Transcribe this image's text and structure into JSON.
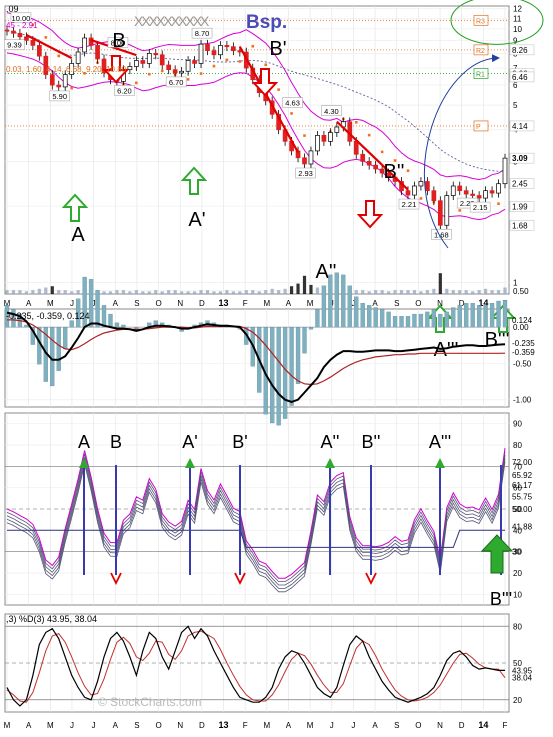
{
  "header": {
    "price_label": ".09",
    "ma_params": "45 - 2.91",
    "symbol": "Bsp.",
    "redacted_ticker": "XXXXXXXXXX",
    "overlay_params": "0.03, 1.60, 4.14, 6.68, 9.20, 10.80"
  },
  "watermark": "© StockCharts.com",
  "chart_data": [
    {
      "panel": "price",
      "type": "candlestick",
      "title": "Bsp.",
      "x_months": [
        "M",
        "A",
        "M",
        "J",
        "J",
        "A",
        "S",
        "O",
        "N",
        "D",
        "13",
        "F",
        "M",
        "A",
        "M",
        "J",
        "J",
        "A",
        "S",
        "O",
        "N",
        "D",
        "14",
        "F"
      ],
      "y_ticks": [
        1,
        2,
        3,
        4,
        5,
        6,
        7,
        8,
        9,
        10,
        11,
        12
      ],
      "ylim": [
        0.9,
        12.3
      ],
      "scale": "log",
      "close_series": [
        9.8,
        9.6,
        9.3,
        9.0,
        8.6,
        7.8,
        6.6,
        6.0,
        5.9,
        6.6,
        7.3,
        8.1,
        9.2,
        8.6,
        7.6,
        6.7,
        6.3,
        6.2,
        6.9,
        7.1,
        7.5,
        7.3,
        8.0,
        7.9,
        7.2,
        6.9,
        6.7,
        6.8,
        7.5,
        7.3,
        8.7,
        8.2,
        7.9,
        8.6,
        8.5,
        8.2,
        8.1,
        7.0,
        6.3,
        5.6,
        5.2,
        4.6,
        4.0,
        3.6,
        3.3,
        3.1,
        2.93,
        3.3,
        3.8,
        3.6,
        3.9,
        4.1,
        4.3,
        3.6,
        3.2,
        3.0,
        2.9,
        2.8,
        2.7,
        2.6,
        2.5,
        2.3,
        2.21,
        2.4,
        2.5,
        2.3,
        2.1,
        1.68,
        2.2,
        2.4,
        2.3,
        2.23,
        2.2,
        2.15,
        2.3,
        2.25,
        2.45,
        3.09
      ],
      "price_annotations": [
        "10.00",
        "9.39",
        "8.00",
        "8.70",
        "6.70",
        "6.20",
        "5.90",
        "4.63",
        "4.30",
        "2.93",
        "2.21",
        "2.23",
        "2.15",
        "1.68"
      ],
      "right_axis_labels": [
        "8.26",
        "6.66",
        "6.46",
        "4.14",
        "3.09",
        "2.45",
        "1.99",
        "1.68"
      ],
      "level_markers": [
        "R3",
        "R2",
        "R1",
        "P"
      ],
      "level_values": [
        10.8,
        8.26,
        6.66,
        4.14
      ],
      "wave_labels": [
        "A",
        "B",
        "A'",
        "B'",
        "A''",
        "B''",
        "A'''",
        "B'''"
      ],
      "volume": [
        3,
        3,
        3,
        2,
        3,
        4,
        5,
        6,
        3,
        3,
        2,
        3,
        4,
        3,
        3,
        2,
        2,
        3,
        3,
        2,
        3,
        2,
        2,
        3,
        2,
        3,
        3,
        2,
        2,
        2,
        3,
        3,
        2,
        2,
        3,
        2,
        2,
        3,
        3,
        2,
        3,
        4,
        3,
        4,
        6,
        8,
        14,
        7,
        5,
        6,
        4,
        5,
        4,
        3,
        3,
        3,
        2,
        3,
        3,
        2,
        3,
        3,
        3,
        3,
        2,
        3,
        4,
        16,
        4,
        3,
        3,
        3,
        2,
        3,
        4,
        3,
        3,
        5
      ],
      "volume_highlight": "#c06070"
    },
    {
      "panel": "macd",
      "type": "line",
      "params": "-0.235, -0.359, 0.124",
      "legend": [
        "-0.235",
        "-0.359",
        "0.124"
      ],
      "y_ticks": [
        0.5,
        0.0,
        -0.5,
        -1.0
      ],
      "ylim": [
        -1.1,
        0.25
      ],
      "right_axis_labels": [
        "0.124",
        "-0.235",
        "-0.359"
      ],
      "macd": [
        0.2,
        0.18,
        0.15,
        0.08,
        -0.05,
        -0.2,
        -0.35,
        -0.45,
        -0.45,
        -0.4,
        -0.28,
        -0.15,
        0.0,
        0.05,
        0.05,
        0.02,
        0.0,
        -0.02,
        -0.02,
        -0.03,
        -0.05,
        -0.03,
        0.0,
        0.02,
        0.02,
        0.01,
        0.0,
        -0.02,
        -0.02,
        0.0,
        0.02,
        0.04,
        0.03,
        0.02,
        0.02,
        0.01,
        0.0,
        -0.1,
        -0.25,
        -0.45,
        -0.65,
        -0.8,
        -0.92,
        -1.0,
        -1.03,
        -1.0,
        -0.9,
        -0.8,
        -0.7,
        -0.55,
        -0.45,
        -0.38,
        -0.33,
        -0.33,
        -0.34,
        -0.34,
        -0.33,
        -0.32,
        -0.32,
        -0.32,
        -0.33,
        -0.33,
        -0.32,
        -0.31,
        -0.3,
        -0.29,
        -0.28,
        -0.3,
        -0.29,
        -0.27,
        -0.26,
        -0.25,
        -0.25,
        -0.26,
        -0.26,
        -0.25,
        -0.24,
        -0.235
      ],
      "signal": [
        0.1,
        0.1,
        0.09,
        0.07,
        0.03,
        -0.03,
        -0.1,
        -0.18,
        -0.25,
        -0.3,
        -0.31,
        -0.28,
        -0.23,
        -0.17,
        -0.12,
        -0.08,
        -0.06,
        -0.04,
        -0.03,
        -0.03,
        -0.03,
        -0.03,
        -0.02,
        -0.01,
        0.0,
        0.0,
        0.0,
        0.0,
        -0.01,
        -0.01,
        0.0,
        0.01,
        0.01,
        0.01,
        0.01,
        0.01,
        0.01,
        -0.02,
        -0.07,
        -0.15,
        -0.25,
        -0.36,
        -0.47,
        -0.58,
        -0.67,
        -0.74,
        -0.78,
        -0.79,
        -0.78,
        -0.74,
        -0.69,
        -0.63,
        -0.57,
        -0.52,
        -0.48,
        -0.45,
        -0.43,
        -0.41,
        -0.4,
        -0.39,
        -0.38,
        -0.38,
        -0.37,
        -0.37,
        -0.36,
        -0.36,
        -0.36,
        -0.36,
        -0.36,
        -0.36,
        -0.36,
        -0.36,
        -0.36,
        -0.36,
        -0.36,
        -0.36,
        -0.36,
        -0.359
      ]
    },
    {
      "panel": "rsi",
      "type": "line",
      "y_ticks": [
        90,
        80,
        70,
        60,
        50,
        40,
        30,
        20,
        10
      ],
      "ylim": [
        5,
        95
      ],
      "right_axis_labels": [
        "72.00",
        "65.92",
        "61.17",
        "55.75",
        "50.00",
        "41.88",
        "30"
      ],
      "wave_labels": [
        "A",
        "B",
        "A'",
        "B'",
        "A''",
        "B''",
        "A'''",
        "B'''"
      ]
    },
    {
      "panel": "stochastic",
      "type": "line",
      "params": ",3) %D(3) 43.95, 38.04",
      "legend": [
        "43.95",
        "38.04"
      ],
      "y_ticks": [
        80,
        50,
        20
      ],
      "ylim": [
        10,
        90
      ],
      "right_axis_labels": [
        "43.95",
        "38.04"
      ],
      "pct_k": [
        30,
        20,
        15,
        20,
        40,
        65,
        75,
        78,
        70,
        55,
        40,
        30,
        22,
        20,
        35,
        55,
        70,
        75,
        68,
        55,
        40,
        60,
        75,
        70,
        55,
        45,
        60,
        75,
        80,
        70,
        78,
        72,
        60,
        50,
        40,
        30,
        22,
        20,
        18,
        18,
        22,
        30,
        45,
        55,
        60,
        58,
        50,
        40,
        30,
        25,
        22,
        30,
        48,
        65,
        72,
        68,
        55,
        45,
        35,
        28,
        22,
        20,
        18,
        20,
        22,
        25,
        30,
        40,
        52,
        58,
        60,
        55,
        48,
        45,
        46,
        45,
        44,
        43.95
      ],
      "pct_d": [
        28,
        24,
        19,
        18,
        26,
        42,
        60,
        72,
        74,
        67,
        55,
        42,
        31,
        24,
        25,
        37,
        53,
        67,
        71,
        66,
        55,
        52,
        58,
        68,
        67,
        57,
        53,
        60,
        72,
        75,
        76,
        73,
        70,
        61,
        50,
        40,
        31,
        24,
        20,
        19,
        19,
        24,
        32,
        43,
        53,
        58,
        56,
        49,
        40,
        32,
        26,
        26,
        33,
        48,
        62,
        68,
        65,
        56,
        45,
        36,
        28,
        23,
        20,
        19,
        20,
        22,
        26,
        32,
        41,
        50,
        57,
        58,
        54,
        49,
        46,
        45,
        45,
        38.04
      ]
    }
  ],
  "colors": {
    "bollinger": "#d800d8",
    "sar": "#f07020",
    "down_trend": "#e00000",
    "up_arrow": "#2eaa2e",
    "down_arrow": "#e00000",
    "vertical_line": "#3a3ab0",
    "macd_line": "#000000",
    "signal_line": "#b02020",
    "histogram": "#7fb0c0",
    "green_ellipse": "#20a020",
    "watermark": "#bbbbbb"
  }
}
